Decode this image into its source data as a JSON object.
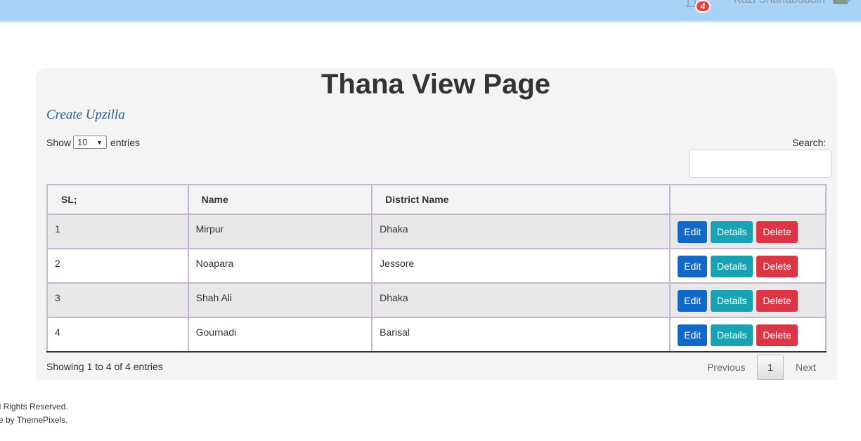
{
  "header": {
    "notification_count": "4",
    "user_name": "Kazi Shahabuddin",
    "icons": [
      "bell-icon",
      "avatar-icon"
    ]
  },
  "page": {
    "title": "Thana View Page",
    "create_link": "Create Upzilla"
  },
  "controls": {
    "show_label": "Show",
    "page_length": "10",
    "entries_label": "entries",
    "search_label": "Search:",
    "search_value": ""
  },
  "table": {
    "columns": [
      "SL;",
      "Name",
      "District Name",
      ""
    ],
    "rows": [
      {
        "sl": "1",
        "name": "Mirpur",
        "district": "Dhaka"
      },
      {
        "sl": "2",
        "name": "Noapara",
        "district": "Jessore"
      },
      {
        "sl": "3",
        "name": "Shah Ali",
        "district": "Dhaka"
      },
      {
        "sl": "4",
        "name": "Gournadi",
        "district": "Barisal"
      }
    ],
    "actions": {
      "edit": "Edit",
      "details": "Details",
      "delete": "Delete"
    }
  },
  "pagination": {
    "info": "Showing 1 to 4 of 4 entries",
    "previous": "Previous",
    "current_page": "1",
    "next": "Next"
  },
  "footer": {
    "line1": "ll Rights Reserved.",
    "line2": "e by ThemePixels."
  },
  "colors": {
    "topbar": "#a8d3f6",
    "edit": "#1168c6",
    "details": "#19a2b4",
    "delete": "#dc3545",
    "link": "#2b5d8f"
  }
}
